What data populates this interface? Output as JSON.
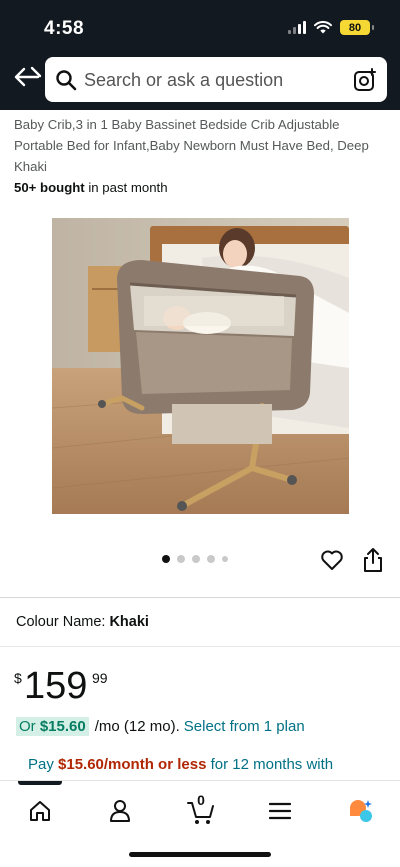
{
  "status_bar": {
    "time": "4:58",
    "battery": "80"
  },
  "search": {
    "placeholder": "Search or ask a question"
  },
  "product": {
    "title": "Baby Crib,3 in 1 Baby Bassinet Bedside Crib Adjustable Portable Bed for Infant,Baby Newborn Must Have Bed, Deep Khaki",
    "bought_count": "50+ bought",
    "bought_suffix": " in past month",
    "image_count": 5,
    "active_image": 1
  },
  "colour": {
    "label": "Colour Name:",
    "value": "Khaki"
  },
  "price": {
    "currency": "$",
    "whole": "159",
    "fraction": "99"
  },
  "monthly": {
    "prefix": "Or ",
    "amount": "$15.60",
    "suffix": "/mo (12 mo).",
    "link": "Select from 1 plan"
  },
  "pay": {
    "prefix": "Pay ",
    "amount": "$15.60/month or less",
    "suffix": " for 12 months with"
  },
  "cart": {
    "count": "0"
  },
  "colors": {
    "header_bg": "#131921",
    "link": "#007185",
    "deal_red": "#b12704",
    "green_bg": "#d4f0e6",
    "green_text": "#067d62"
  },
  "icons": [
    "back-arrow-icon",
    "search-icon",
    "camera-icon",
    "heart-icon",
    "share-icon",
    "home-icon",
    "account-icon",
    "cart-icon",
    "menu-icon",
    "rufus-ai-icon"
  ]
}
